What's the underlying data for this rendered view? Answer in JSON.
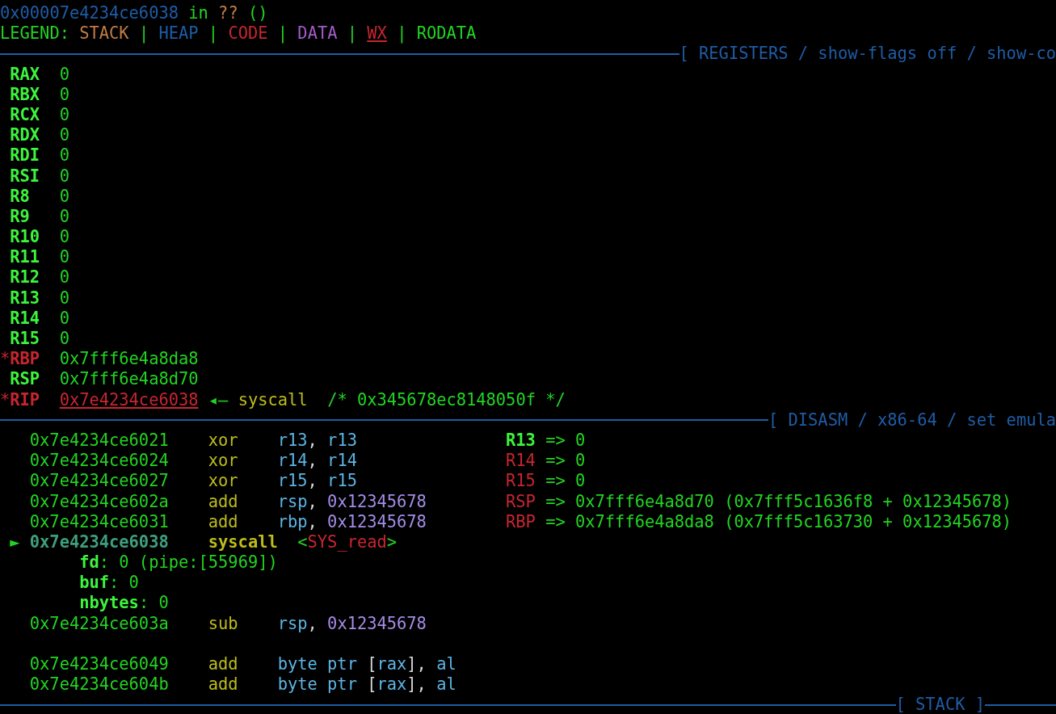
{
  "location": {
    "address": "0x00007e4234ce6038",
    "word": "in",
    "symbol": "??",
    "args": "()"
  },
  "legend": {
    "label": "LEGEND:",
    "separator": "|",
    "items": [
      {
        "text": "STACK",
        "kind": "stack"
      },
      {
        "text": "HEAP",
        "kind": "heap"
      },
      {
        "text": "CODE",
        "kind": "code"
      },
      {
        "text": "DATA",
        "kind": "data"
      },
      {
        "text": "WX",
        "kind": "wx"
      },
      {
        "text": "RODATA",
        "kind": "rodata"
      }
    ]
  },
  "registers_header": "[ REGISTERS / show-flags off / show-co",
  "registers": [
    {
      "name": "RAX",
      "value": "0",
      "changed": false,
      "kind": "plain"
    },
    {
      "name": "RBX",
      "value": "0",
      "changed": false,
      "kind": "plain"
    },
    {
      "name": "RCX",
      "value": "0",
      "changed": false,
      "kind": "plain"
    },
    {
      "name": "RDX",
      "value": "0",
      "changed": false,
      "kind": "plain"
    },
    {
      "name": "RDI",
      "value": "0",
      "changed": false,
      "kind": "plain"
    },
    {
      "name": "RSI",
      "value": "0",
      "changed": false,
      "kind": "plain"
    },
    {
      "name": "R8",
      "value": "0",
      "changed": false,
      "kind": "plain"
    },
    {
      "name": "R9",
      "value": "0",
      "changed": false,
      "kind": "plain"
    },
    {
      "name": "R10",
      "value": "0",
      "changed": false,
      "kind": "plain"
    },
    {
      "name": "R11",
      "value": "0",
      "changed": false,
      "kind": "plain"
    },
    {
      "name": "R12",
      "value": "0",
      "changed": false,
      "kind": "plain"
    },
    {
      "name": "R13",
      "value": "0",
      "changed": false,
      "kind": "plain"
    },
    {
      "name": "R14",
      "value": "0",
      "changed": false,
      "kind": "plain"
    },
    {
      "name": "R15",
      "value": "0",
      "changed": false,
      "kind": "plain"
    },
    {
      "marker": "*",
      "name": "RBP",
      "value": "0x7fff6e4a8da8",
      "changed": true,
      "kind": "plain"
    },
    {
      "name": "RSP",
      "value": "0x7fff6e4a8d70",
      "changed": false,
      "kind": "plain"
    },
    {
      "marker": "*",
      "name": "RIP",
      "value": "0x7e4234ce6038",
      "changed": true,
      "kind": "code",
      "arrow": "◂—",
      "instruction": "syscall",
      "comment": "/* 0x345678ec8148050f */"
    }
  ],
  "disasm_header": "[ DISASM / x86-64 / set emula",
  "disasm": [
    {
      "kind": "instr",
      "current": false,
      "address": "0x7e4234ce6021",
      "mnemonic": "xor",
      "operands": [
        {
          "text": "r13",
          "kind": "reg"
        },
        {
          "text": ", ",
          "kind": "punct"
        },
        {
          "text": "r13",
          "kind": "reg"
        }
      ],
      "annotation": {
        "register": "R13",
        "changed": false,
        "text": " => 0"
      }
    },
    {
      "kind": "instr",
      "current": false,
      "address": "0x7e4234ce6024",
      "mnemonic": "xor",
      "operands": [
        {
          "text": "r14",
          "kind": "reg"
        },
        {
          "text": ", ",
          "kind": "punct"
        },
        {
          "text": "r14",
          "kind": "reg"
        }
      ],
      "annotation": {
        "register": "R14",
        "changed": true,
        "text": " => 0"
      }
    },
    {
      "kind": "instr",
      "current": false,
      "address": "0x7e4234ce6027",
      "mnemonic": "xor",
      "operands": [
        {
          "text": "r15",
          "kind": "reg"
        },
        {
          "text": ", ",
          "kind": "punct"
        },
        {
          "text": "r15",
          "kind": "reg"
        }
      ],
      "annotation": {
        "register": "R15",
        "changed": true,
        "text": " => 0"
      }
    },
    {
      "kind": "instr",
      "current": false,
      "address": "0x7e4234ce602a",
      "mnemonic": "add",
      "operands": [
        {
          "text": "rsp",
          "kind": "reg"
        },
        {
          "text": ", ",
          "kind": "punct"
        },
        {
          "text": "0x12345678",
          "kind": "imm"
        }
      ],
      "annotation": {
        "register": "RSP",
        "changed": true,
        "text": " => 0x7fff6e4a8d70 (0x7fff5c1636f8 + 0x12345678)"
      }
    },
    {
      "kind": "instr",
      "current": false,
      "address": "0x7e4234ce6031",
      "mnemonic": "add",
      "operands": [
        {
          "text": "rbp",
          "kind": "reg"
        },
        {
          "text": ", ",
          "kind": "punct"
        },
        {
          "text": "0x12345678",
          "kind": "imm"
        }
      ],
      "annotation": {
        "register": "RBP",
        "changed": true,
        "text": " => 0x7fff6e4a8da8 (0x7fff5c163730 + 0x12345678)"
      }
    },
    {
      "kind": "instr",
      "current": true,
      "marker": "►",
      "address": "0x7e4234ce6038",
      "mnemonic": "syscall",
      "operands": [
        {
          "text": "<",
          "kind": "bracket"
        },
        {
          "text": "SYS_read",
          "kind": "symbol"
        },
        {
          "text": ">",
          "kind": "bracket"
        }
      ]
    },
    {
      "kind": "arg",
      "name": "fd",
      "value": ": 0 (pipe:[55969])"
    },
    {
      "kind": "arg",
      "name": "buf",
      "value": ": 0"
    },
    {
      "kind": "arg",
      "name": "nbytes",
      "value": ": 0"
    },
    {
      "kind": "instr",
      "current": false,
      "address": "0x7e4234ce603a",
      "mnemonic": "sub",
      "operands": [
        {
          "text": "rsp",
          "kind": "reg"
        },
        {
          "text": ", ",
          "kind": "punct"
        },
        {
          "text": "0x12345678",
          "kind": "imm"
        }
      ]
    },
    {
      "kind": "blank"
    },
    {
      "kind": "instr",
      "current": false,
      "address": "0x7e4234ce6049",
      "mnemonic": "add",
      "operands": [
        {
          "text": "byte ptr ",
          "kind": "reg"
        },
        {
          "text": "[",
          "kind": "punct"
        },
        {
          "text": "rax",
          "kind": "reg"
        },
        {
          "text": "], ",
          "kind": "punct"
        },
        {
          "text": "al",
          "kind": "reg"
        }
      ]
    },
    {
      "kind": "instr",
      "current": false,
      "address": "0x7e4234ce604b",
      "mnemonic": "add",
      "operands": [
        {
          "text": "byte ptr ",
          "kind": "reg"
        },
        {
          "text": "[",
          "kind": "punct"
        },
        {
          "text": "rax",
          "kind": "reg"
        },
        {
          "text": "], ",
          "kind": "punct"
        },
        {
          "text": "al",
          "kind": "reg"
        }
      ]
    }
  ],
  "stack_header": "[ STACK ]"
}
